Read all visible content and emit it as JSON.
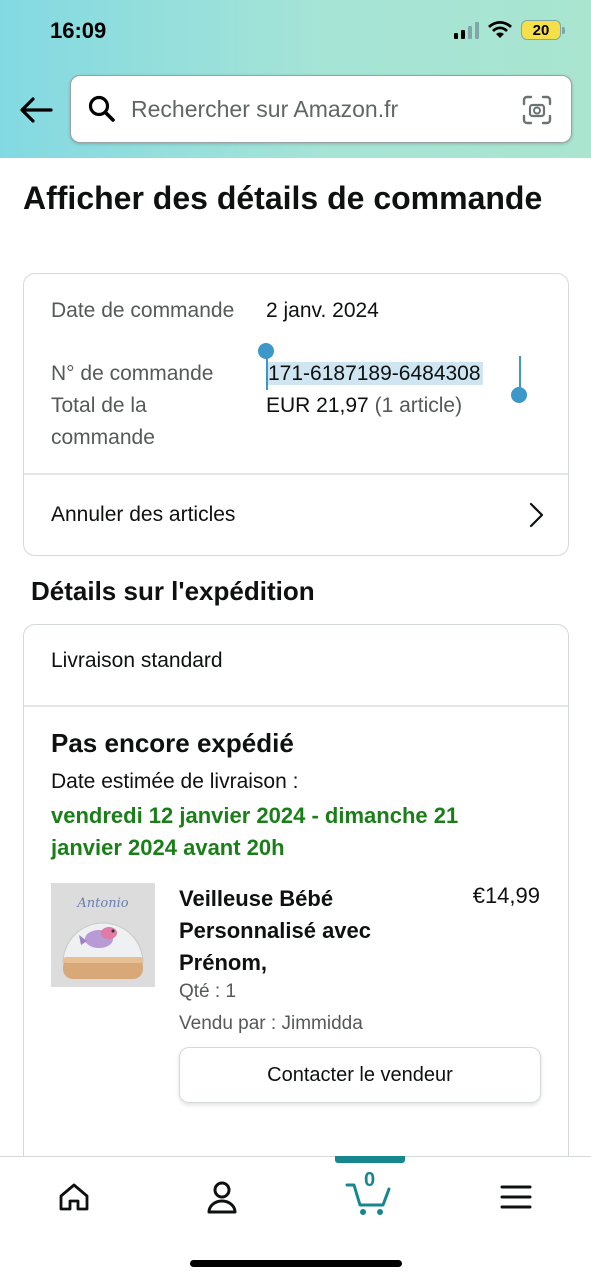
{
  "status_bar": {
    "time": "16:09",
    "battery": "20"
  },
  "search": {
    "placeholder": "Rechercher sur Amazon.fr"
  },
  "page": {
    "title": "Afficher des détails de commande"
  },
  "order": {
    "date_label": "Date de commande",
    "date_value": "2 janv. 2024",
    "number_label": "N° de commande",
    "number_value": "171-6187189-6484308",
    "total_label": "Total de la commande",
    "total_value": "EUR 21,97",
    "total_count": "(1 article)",
    "cancel_label": "Annuler des articles"
  },
  "shipping": {
    "section_title": "Détails sur l'expédition",
    "type": "Livraison standard",
    "status": "Pas encore expédié",
    "estimate_label": "Date estimée de livraison :",
    "estimate_value": "vendredi 12 janvier 2024 - dimanche 21 janvier 2024 avant 20h",
    "item": {
      "title": "Veilleuse Bébé Personnalisé avec Prénom,",
      "price": "€14,99",
      "qty": "Qté : 1",
      "seller": "Vendu par : Jimmidda",
      "image_text": "Antonio",
      "contact_label": "Contacter le vendeur"
    }
  },
  "nav": {
    "cart_count": "0",
    "items": [
      "home-icon",
      "account-icon",
      "cart-icon",
      "menu-icon"
    ]
  },
  "colors": {
    "accent": "#16878f",
    "delivery": "#1a7f18",
    "selection": "#3d97c9"
  }
}
